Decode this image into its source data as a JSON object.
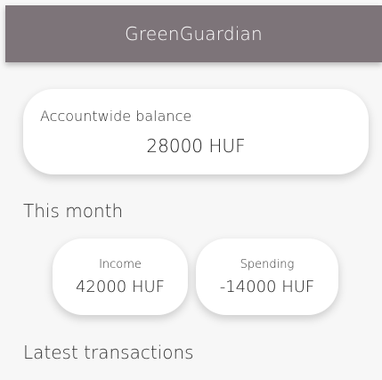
{
  "app_bar": {
    "title": "GreenGuardian"
  },
  "balance": {
    "label": "Accountwide balance",
    "value": "28000 HUF"
  },
  "this_month": {
    "title": "This month",
    "income": {
      "label": "Income",
      "value": "42000 HUF"
    },
    "spending": {
      "label": "Spending",
      "value": "-14000 HUF"
    }
  },
  "latest": {
    "title": "Latest transactions"
  },
  "colors": {
    "app_bar_bg": "#7d7479",
    "page_bg": "#f7f7f7",
    "card_bg": "#ffffff"
  }
}
